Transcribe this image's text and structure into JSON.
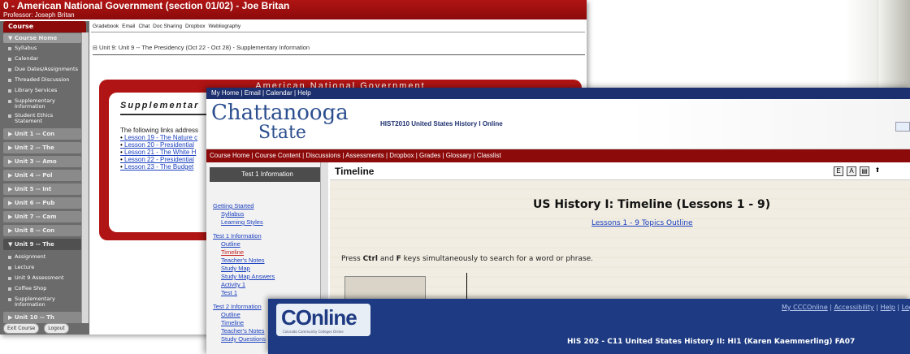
{
  "win1": {
    "title": "0 - American National Government (section 01/02) - Joe Britan",
    "professor": "Professor: Joseph Britan",
    "course_tab": "Course",
    "course_home": "▼ Course Home",
    "side_items": [
      "Syllabus",
      "Calendar",
      "Due Dates/Assignments",
      "Threaded Discussion",
      "Library Services",
      "Supplementary Information",
      "Student Ethics Statement"
    ],
    "units": [
      "▶ Unit 1 -- Con",
      "▶ Unit 2 -- The",
      "▶ Unit 3 -- Amo",
      "▶ Unit 4 -- Pol",
      "▶ Unit 5 -- Int",
      "▶ Unit 6 -- Pub",
      "▶ Unit 7 -- Cam",
      "▶ Unit 8 -- Con"
    ],
    "open_unit": "▼ Unit 9 -- The",
    "unit9_items": [
      "Assignment",
      "Lecture",
      "Unit 9 Assessment",
      "Coffee Shop",
      "Supplementary Information"
    ],
    "next_unit": "▶ Unit 10 -- Th",
    "exit": "Exit Course",
    "logout": "Logout",
    "tabs": [
      "Gradebook",
      "Email",
      "Chat",
      "Doc Sharing",
      "Dropbox",
      "Webliography"
    ],
    "unit_line": "Unit 9:  Unit 9 -- The Presidency (Oct 22 - Oct 28) - Supplementary Information",
    "box_head": "American National Government",
    "box_title": "Supplementar",
    "box_text": "The following links address",
    "links": [
      "Lesson 19 - The Nature c",
      "Lesson 20 - Presidential",
      "Lesson 21 - The White H",
      "Lesson 22 - Presidential",
      "Lesson 23 - The Budget"
    ]
  },
  "win2": {
    "top_links": "My Home | Email | Calendar | Help",
    "logo_top": "Chattanooga",
    "logo_bottom": "State",
    "course": "HIST2010 United States History I Online",
    "nav": "Course Home | Course Content | Discussions | Assessments | Dropbox | Grades | Glossary | Classlist",
    "left_head": "Test 1 Information",
    "left_links": [
      {
        "t": "Getting Started",
        "k": "h"
      },
      {
        "t": "Syllabus",
        "k": "i"
      },
      {
        "t": "Learning Styles",
        "k": "i"
      },
      {
        "t": "Test 1 Information",
        "k": "h"
      },
      {
        "t": "Outline",
        "k": "i"
      },
      {
        "t": "Timeline",
        "k": "cur"
      },
      {
        "t": "Teacher's Notes",
        "k": "i"
      },
      {
        "t": "Study Map",
        "k": "i"
      },
      {
        "t": "Study Map Answers",
        "k": "i"
      },
      {
        "t": "Activity 1",
        "k": "i"
      },
      {
        "t": "Test 1",
        "k": "i"
      },
      {
        "t": "Test 2 Information",
        "k": "h"
      },
      {
        "t": "Outline",
        "k": "i"
      },
      {
        "t": "Timeline",
        "k": "i"
      },
      {
        "t": "Teacher's Notes",
        "k": "i"
      },
      {
        "t": "Study Questions",
        "k": "i"
      }
    ],
    "page_title": "Timeline",
    "btn_e": "E",
    "btn_a": "A",
    "doc_title": "US History I: Timeline (Lessons 1 - 9)",
    "doc_link": "Lessons 1 - 9 Topics Outline",
    "press_pre": "Press ",
    "press_ctrl": "Ctrl",
    "press_and": " and ",
    "press_f": "F",
    "press_post": " keys simultaneously to search for a word or phrase."
  },
  "win3": {
    "logo": "COnline",
    "logo_sub": "Colorado Community Colleges Online",
    "links": [
      "My CCCOnline",
      "Accessibility",
      "Help",
      "Log ou"
    ],
    "course": "HIS 202 - C11 United States History II: HI1 (Karen Kaemmerling) FA07"
  }
}
